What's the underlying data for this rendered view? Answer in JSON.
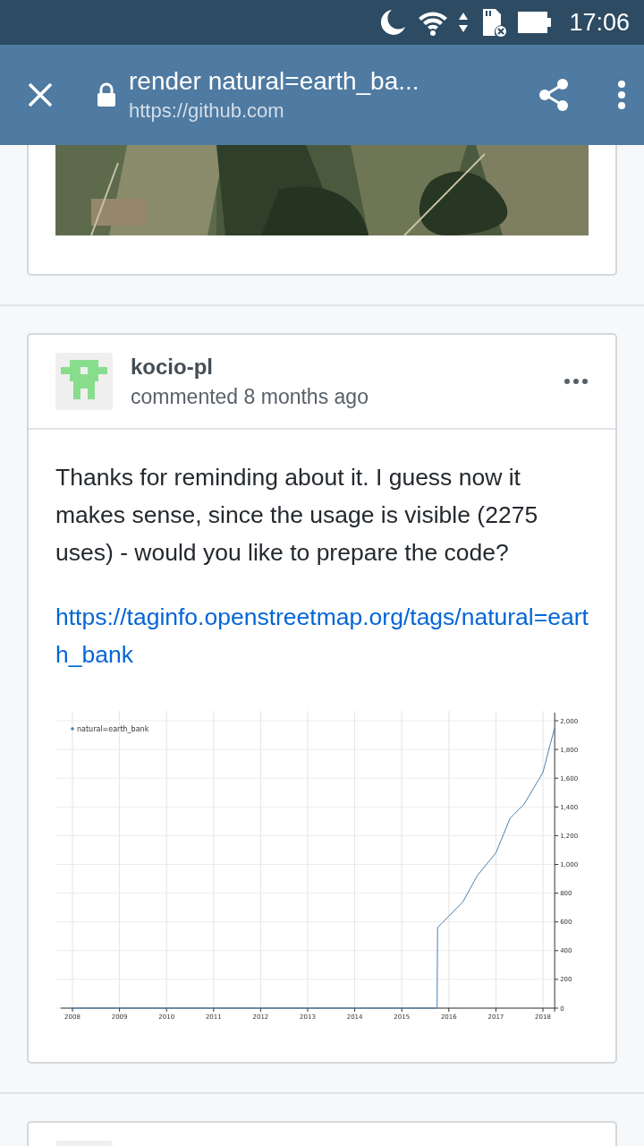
{
  "status_bar": {
    "time": "17:06"
  },
  "toolbar": {
    "title": "render natural=earth_ba...",
    "url": "https://github.com"
  },
  "comment": {
    "author": "kocio-pl",
    "meta": "commented 8 months ago",
    "body": "Thanks for reminding about it. I guess now it makes sense, since the usage is visible (2275 uses) - would you like to prepare the code?",
    "link": "https://taginfo.openstreetmap.org/tags/natural=earth_bank",
    "chart_data": {
      "type": "line",
      "x": [
        2008,
        2015.75,
        2015.76,
        2015.85,
        2016,
        2016.3,
        2016.6,
        2017,
        2017.3,
        2017.6,
        2018,
        2018.15,
        2018.25
      ],
      "series": [
        {
          "name": "natural=earth_bank",
          "color": "#4682b4",
          "values": [
            0,
            0,
            560,
            590,
            640,
            740,
            920,
            1080,
            1320,
            1420,
            1640,
            1830,
            1950
          ]
        }
      ],
      "xlim": [
        2007.75,
        2018.25
      ],
      "ylim": [
        0,
        2000
      ],
      "grid": true,
      "xticks": [
        2008,
        2009,
        2010,
        2011,
        2012,
        2013,
        2014,
        2015,
        2016,
        2017,
        2018
      ],
      "yticks": [
        0,
        200,
        400,
        600,
        800,
        {
          "value": 1000,
          "label": "1,000"
        },
        {
          "value": 1200,
          "label": "1,200"
        },
        {
          "value": 1400,
          "label": "1,400"
        },
        {
          "value": 1600,
          "label": "1,600"
        },
        {
          "value": 1800,
          "label": "1,800"
        },
        {
          "value": 2000,
          "label": "2,000"
        }
      ]
    }
  }
}
